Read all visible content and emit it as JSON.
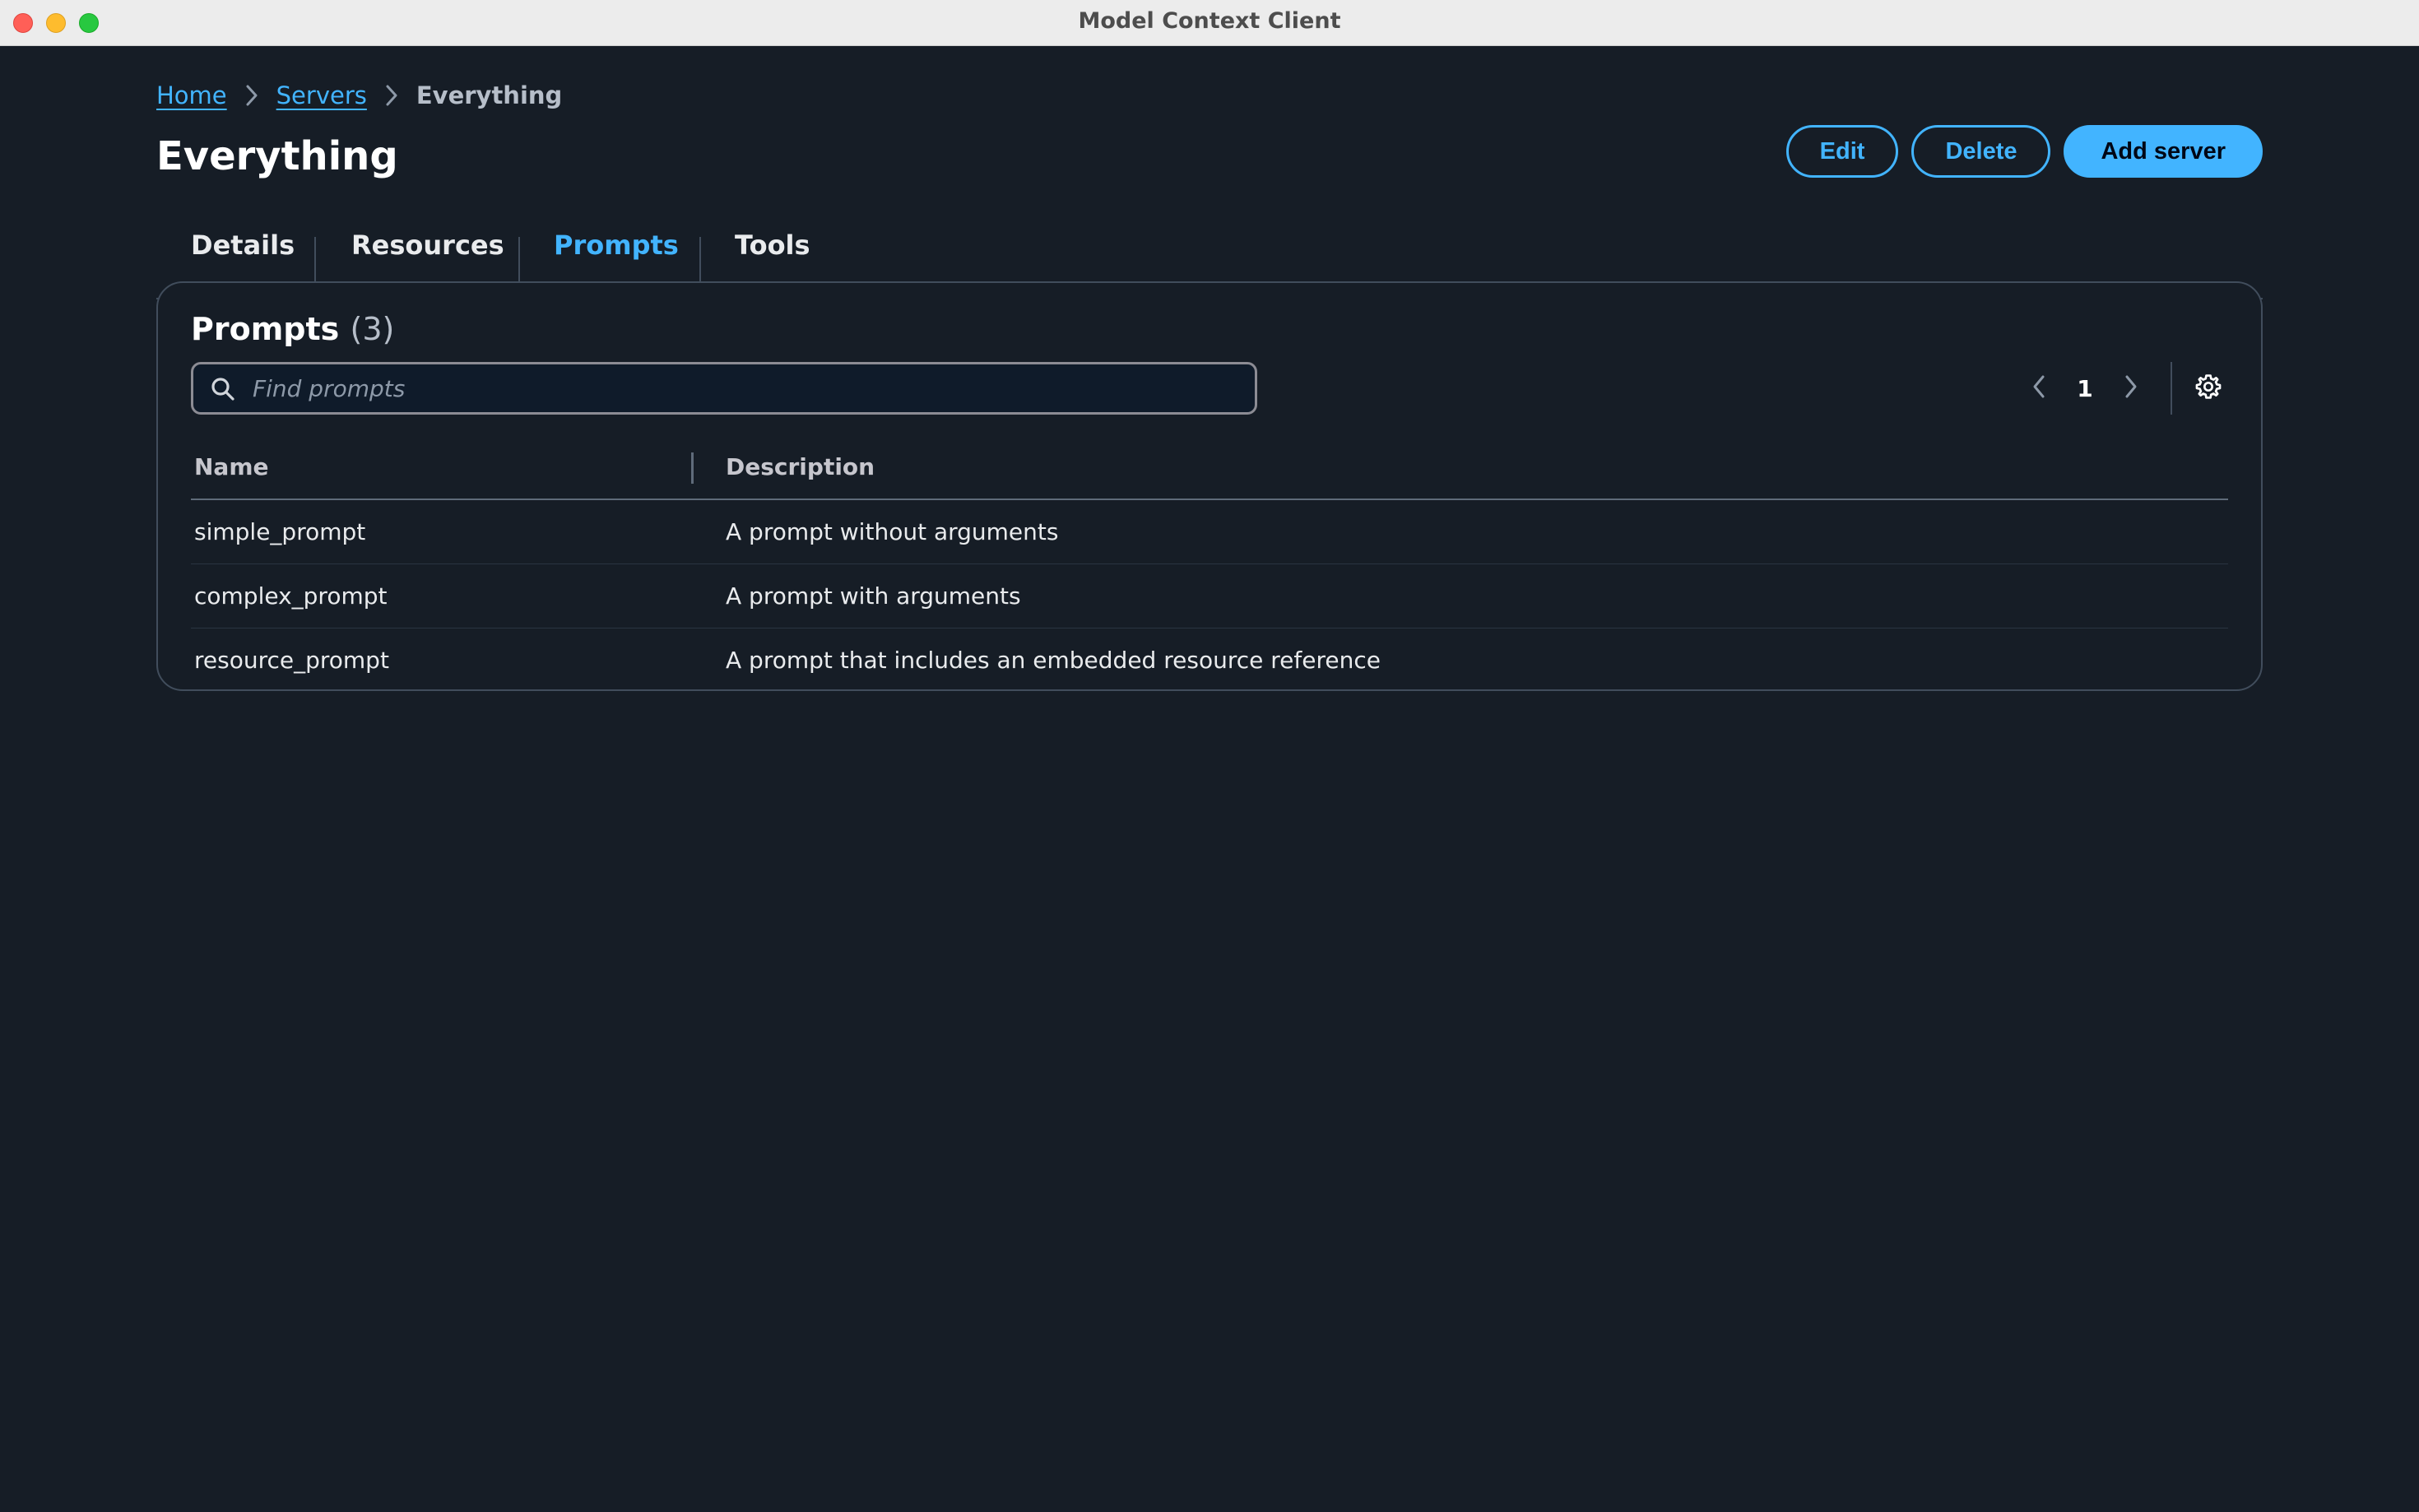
{
  "window": {
    "title": "Model Context Client"
  },
  "breadcrumb": {
    "items": [
      "Home",
      "Servers"
    ],
    "current": "Everything"
  },
  "page": {
    "title": "Everything"
  },
  "actions": {
    "edit": "Edit",
    "delete": "Delete",
    "add_server": "Add server"
  },
  "tabs": [
    {
      "label": "Details",
      "active": false
    },
    {
      "label": "Resources",
      "active": false
    },
    {
      "label": "Prompts",
      "active": true
    },
    {
      "label": "Tools",
      "active": false
    }
  ],
  "prompts": {
    "title": "Prompts",
    "count": "(3)",
    "search": {
      "placeholder": "Find prompts",
      "value": ""
    },
    "pagination": {
      "current_page": "1"
    },
    "columns": {
      "name": "Name",
      "description": "Description"
    },
    "rows": [
      {
        "name": "simple_prompt",
        "description": "A prompt without arguments"
      },
      {
        "name": "complex_prompt",
        "description": "A prompt with arguments"
      },
      {
        "name": "resource_prompt",
        "description": "A prompt that includes an embedded resource reference"
      }
    ]
  },
  "colors": {
    "accent": "#42b4ff",
    "background": "#161d26",
    "border": "#414d5c"
  },
  "icons": [
    "chevron-right-icon",
    "search-icon",
    "chevron-left-icon",
    "settings-gear-icon"
  ]
}
